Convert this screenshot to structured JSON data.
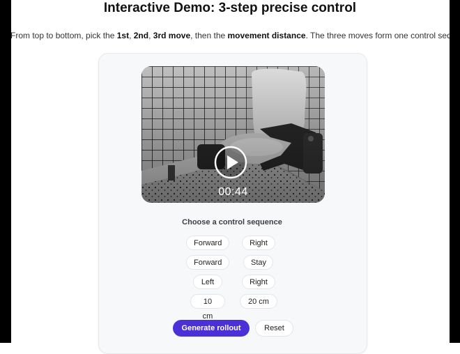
{
  "page": {
    "title": "Interactive Demo: 3-step precise control",
    "intro": {
      "prefix": "From top to bottom, pick the ",
      "first": "1st",
      "sep1": ", ",
      "second": "2nd",
      "sep2": ", ",
      "third": "3rd move",
      "middle": ", then the ",
      "distance": "movement distance",
      "suffix": ". The three moves form one control sequence"
    }
  },
  "video": {
    "duration": "00:44",
    "play_icon": "play-icon"
  },
  "controls": {
    "section_title": "Choose a control sequence",
    "rows": [
      {
        "left": "Forward",
        "right": "Right"
      },
      {
        "left": "Forward",
        "right": "Stay"
      },
      {
        "left": "Left",
        "right": "Right"
      },
      {
        "left": "10 cm",
        "right": "20 cm"
      }
    ],
    "generate_label": "Generate rollout",
    "reset_label": "Reset"
  },
  "colors": {
    "accent": "#4a30d6",
    "card_bg": "#f7f8fa"
  }
}
